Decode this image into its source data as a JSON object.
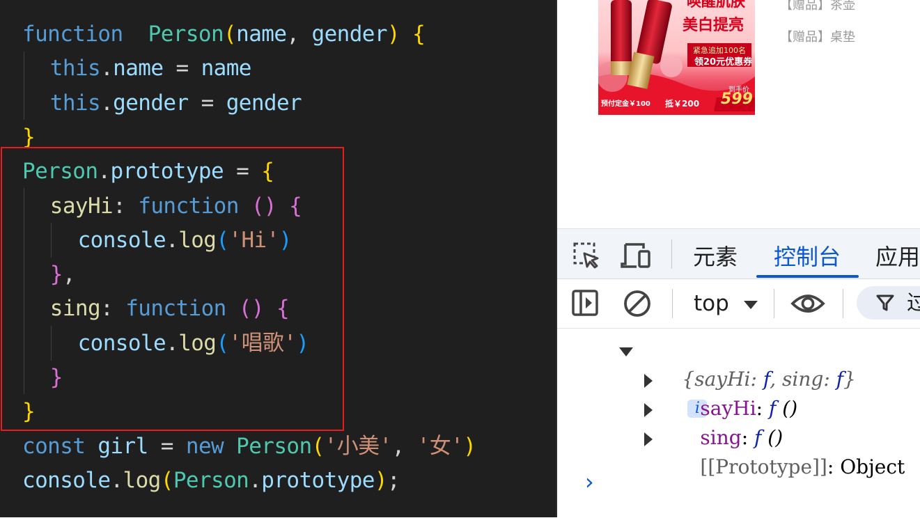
{
  "editor": {
    "lines": [
      [
        [
          "kw",
          "function"
        ],
        [
          "",
          "  "
        ],
        [
          "cls",
          "Person"
        ],
        [
          "b1",
          "("
        ],
        [
          "vr",
          "name"
        ],
        [
          "",
          ", "
        ],
        [
          "vr",
          "gender"
        ],
        [
          "b1",
          ")"
        ],
        [
          "",
          " "
        ],
        [
          "b1",
          "{"
        ]
      ],
      [
        [
          "kw",
          "this"
        ],
        [
          "",
          "."
        ],
        [
          "vr",
          "name"
        ],
        [
          "",
          " = "
        ],
        [
          "vr",
          "name"
        ]
      ],
      [
        [
          "kw",
          "this"
        ],
        [
          "",
          "."
        ],
        [
          "vr",
          "gender"
        ],
        [
          "",
          " = "
        ],
        [
          "vr",
          "gender"
        ]
      ],
      [
        [
          "b1",
          "}"
        ]
      ],
      [
        [
          "cls",
          "Person"
        ],
        [
          "",
          "."
        ],
        [
          "vr",
          "prototype"
        ],
        [
          "",
          " = "
        ],
        [
          "b1",
          "{"
        ]
      ],
      [
        [
          "fn",
          "sayHi"
        ],
        [
          "",
          ": "
        ],
        [
          "kw",
          "function"
        ],
        [
          "",
          " "
        ],
        [
          "b2",
          "()"
        ],
        [
          "",
          " "
        ],
        [
          "b2",
          "{"
        ]
      ],
      [
        [
          "vr",
          "console"
        ],
        [
          "",
          "."
        ],
        [
          "fn",
          "log"
        ],
        [
          "b3",
          "("
        ],
        [
          "st",
          "'Hi'"
        ],
        [
          "b3",
          ")"
        ]
      ],
      [
        [
          "b2",
          "}"
        ],
        [
          "",
          ","
        ]
      ],
      [
        [
          "fn",
          "sing"
        ],
        [
          "",
          ": "
        ],
        [
          "kw",
          "function"
        ],
        [
          "",
          " "
        ],
        [
          "b2",
          "()"
        ],
        [
          "",
          " "
        ],
        [
          "b2",
          "{"
        ]
      ],
      [
        [
          "vr",
          "console"
        ],
        [
          "",
          "."
        ],
        [
          "fn",
          "log"
        ],
        [
          "b3",
          "("
        ],
        [
          "st",
          "'唱歌'"
        ],
        [
          "b3",
          ")"
        ]
      ],
      [
        [
          "b2",
          "}"
        ]
      ],
      [
        [
          "b1",
          "}"
        ]
      ],
      [
        [
          "kw",
          "const"
        ],
        [
          "",
          " "
        ],
        [
          "vr",
          "girl"
        ],
        [
          "",
          " = "
        ],
        [
          "kw",
          "new"
        ],
        [
          "",
          " "
        ],
        [
          "cls",
          "Person"
        ],
        [
          "b1",
          "("
        ],
        [
          "st",
          "'小美'"
        ],
        [
          "",
          ", "
        ],
        [
          "st",
          "'女'"
        ],
        [
          "b1",
          ")"
        ]
      ],
      [
        [
          "vr",
          "console"
        ],
        [
          "",
          "."
        ],
        [
          "fn",
          "log"
        ],
        [
          "b1",
          "("
        ],
        [
          "cls",
          "Person"
        ],
        [
          "",
          "."
        ],
        [
          "vr",
          "prototype"
        ],
        [
          "b1",
          ")"
        ],
        [
          "",
          ";"
        ]
      ]
    ]
  },
  "browser_page": {
    "ad": {
      "headline_1": "唤醒肌肤",
      "headline_2": "美白提亮",
      "coupon_1": "紧急追加100名",
      "coupon_2": "领20元优惠券",
      "price_label": "到手价",
      "price": "599",
      "deposit": "预付定金￥100",
      "deduct": "抵￥200"
    },
    "gifts": [
      "【赠品】茶壶",
      "【赠品】桌垫"
    ]
  },
  "devtools": {
    "tabs": [
      "元素",
      "控制台",
      "应用"
    ],
    "active_tab": "控制台",
    "context": "top",
    "filter_label": "过",
    "accent_color": "#0b57d0"
  },
  "console": {
    "summary": "{sayHi: f, sing: f}",
    "summary_parts": [
      "{",
      "sayHi",
      ": ",
      "f",
      ", ",
      "sing",
      ": ",
      "f",
      "}"
    ],
    "info_badge": "i",
    "properties": [
      {
        "key": "sayHi",
        "sep": ": ",
        "fsym": "f",
        "value": " ()"
      },
      {
        "key": "sing",
        "sep": ": ",
        "fsym": "f",
        "value": " ()"
      }
    ],
    "prototype": {
      "key": "[[Prototype]]",
      "sep": ": ",
      "value": "Object"
    },
    "prompt": "›"
  }
}
